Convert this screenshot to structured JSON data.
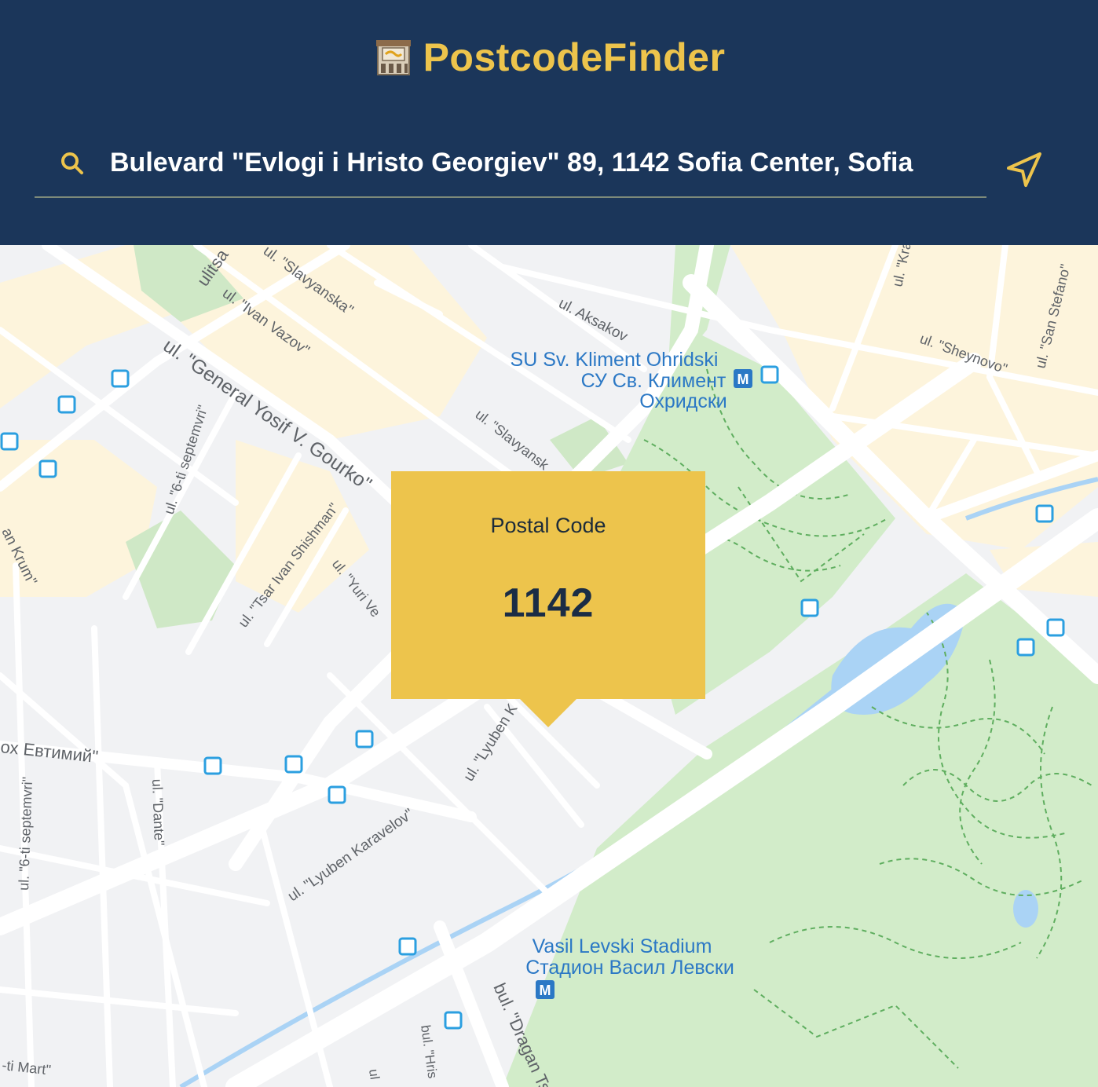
{
  "app": {
    "title": "PostcodeFinder",
    "logo_icon": "post-office-icon",
    "accent_color": "#edc44c",
    "header_color": "#1b365a"
  },
  "search": {
    "value": "Bulevard \"Evlogi i Hristo Georgiev\" 89, 1142 Sofia Center, Sofia",
    "icon": "search-icon",
    "locate_icon": "navigation-arrow-icon"
  },
  "popup": {
    "label": "Postal Code",
    "code": "1142"
  },
  "map": {
    "streets": [
      "ulitsa",
      "ul. \"Slavyanska\"",
      "ul. \"Ivan Vazov\"",
      "ul. \"General Yosif V. Gourko\"",
      "ul. \"6-ti septemvri\"",
      "ul. \"Tsar Ivan Shishman\"",
      "ul. \"Yuri Ve",
      "ul. Aksakov",
      "ul. \"Slavyansk",
      "ul. \"Kra",
      "ul. \"San Stefano\"",
      "ul. \"Sheynovo\"",
      "an Krum\"",
      "ох Евтимий\"",
      "ul. \"Dante\"",
      "ul. \"6-ti septemvri\"",
      "ul. \"Lyuben Karavelov\"",
      "ul. \"Lyuben K",
      "-ti Mart\"",
      "bul. \"Dragan Ts",
      "bul. \"Hris",
      "ul"
    ],
    "places": [
      {
        "line1": "SU Sv. Kliment Ohridski",
        "line2": "СУ Св. Климент",
        "line3": "Охридски"
      },
      {
        "line1": "Vasil Levski Stadium",
        "line2": "Стадион Васил Левски"
      }
    ],
    "metro_label": "M"
  }
}
